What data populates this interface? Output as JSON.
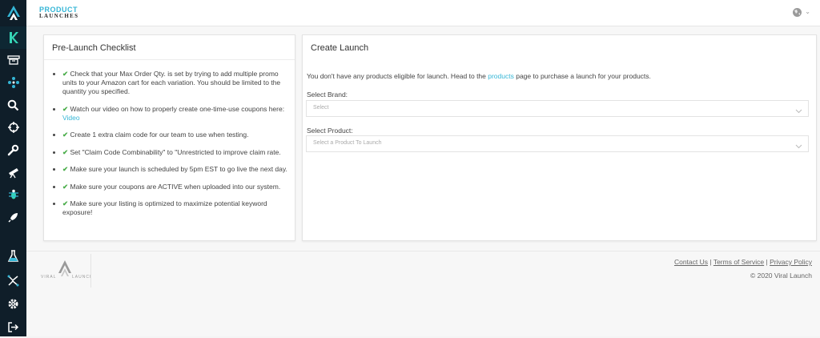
{
  "brand": {
    "line1": "PRODUCT",
    "line2": "LAUNCHES"
  },
  "sidebar": {
    "items": [
      {
        "icon": "k-brand-icon"
      },
      {
        "icon": "product-discovery-icon"
      },
      {
        "icon": "network-icon"
      },
      {
        "icon": "search-icon"
      },
      {
        "icon": "crosshair-icon"
      },
      {
        "icon": "wrench-icon"
      },
      {
        "icon": "telescope-icon"
      },
      {
        "icon": "bug-icon"
      },
      {
        "icon": "rocket-icon"
      },
      {
        "icon": "flask-icon"
      },
      {
        "icon": "split-arrows-icon"
      },
      {
        "icon": "gear-icon"
      },
      {
        "icon": "logout-icon"
      }
    ]
  },
  "checklist": {
    "title": "Pre-Launch Checklist",
    "items": [
      "Check that your Max Order Qty. is set by trying to add multiple promo units to your Amazon cart for each variation. You should be limited to the quantity you specified.",
      "Watch our video on how to properly create one-time-use coupons here: ",
      "Create 1 extra claim code for our team to use when testing.",
      "Set \"Claim Code Combinability\" to \"Unrestricted to improve claim rate.",
      "Make sure your launch is scheduled by 5pm EST to go live the next day.",
      "Make sure your coupons are ACTIVE when uploaded into our system.",
      "Make sure your listing is optimized to maximize potential keyword exposure!"
    ],
    "video_link": "Video",
    "tick": "✔"
  },
  "create_launch": {
    "title": "Create Launch",
    "message_before": "You don't have any products eligible for launch. Head to the ",
    "message_link": "products",
    "message_after": " page to purchase a launch for your products.",
    "brand_label": "Select Brand:",
    "brand_placeholder": "Select",
    "product_label": "Select Product:",
    "product_placeholder": "Select a Product To Launch"
  },
  "footer": {
    "contact": "Contact Us",
    "tos": "Terms of Service",
    "privacy": "Privacy Policy",
    "sep": "|",
    "copyright": "© 2020 Viral Launch",
    "logo_text": "VIRAL LAUNCH"
  },
  "colors": {
    "accent": "#35b6d6",
    "sidebar": "#0f1e29",
    "check": "#4cae4c"
  }
}
